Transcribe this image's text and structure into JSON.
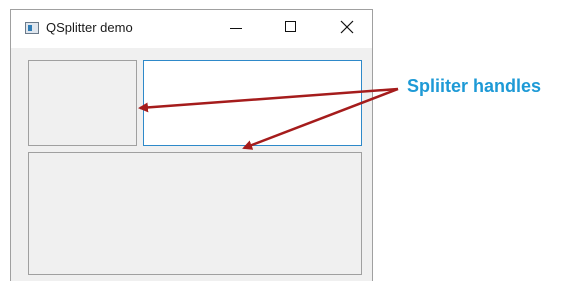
{
  "window": {
    "title": "QSplitter demo"
  },
  "icons": {
    "app": "app-window-icon",
    "minimize": "minimize-icon",
    "maximize": "maximize-icon",
    "close": "close-icon"
  },
  "annotation": {
    "label": "Spliiter handles",
    "color": "#1e9ad6",
    "arrow_color": "#a51c1c"
  },
  "colors": {
    "focus_border": "#2e89c9",
    "pane_background": "#f0f0f0"
  }
}
